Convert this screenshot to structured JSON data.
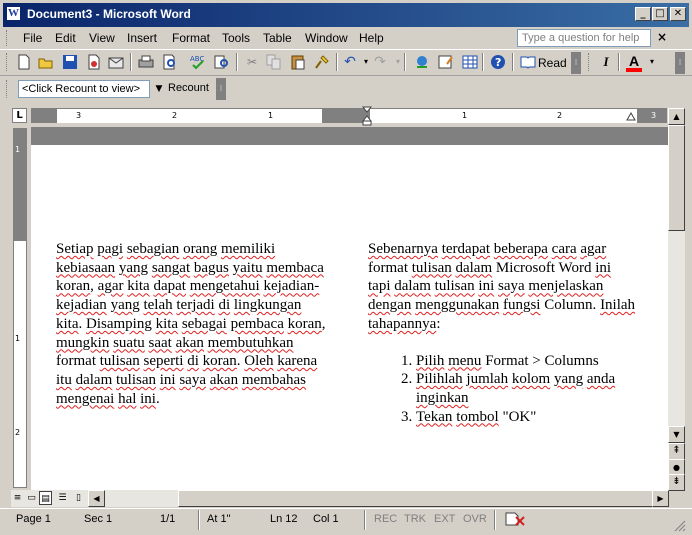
{
  "window": {
    "title": "Document3 - Microsoft Word",
    "app_icon_letter": "W"
  },
  "caption_buttons": {
    "minimize": "_",
    "maximize": "□",
    "close": "✕"
  },
  "menubar": {
    "items": [
      "File",
      "Edit",
      "View",
      "Insert",
      "Format",
      "Tools",
      "Table",
      "Window",
      "Help"
    ],
    "help_placeholder": "Type a question for help",
    "doc_close": "×"
  },
  "toolbar_standard": {
    "read_label": "Read",
    "font_color_letter": "A",
    "italic_letter": "I"
  },
  "toolbar_wordcount": {
    "view_placeholder": "<Click Recount to view>",
    "recount_label": "Recount"
  },
  "ruler": {
    "tab_selector": "L",
    "marks": [
      "3",
      "2",
      "1",
      "1",
      "2",
      "3"
    ]
  },
  "document": {
    "column1": [
      {
        "t": "Setiap",
        "s": true
      },
      {
        "t": " ",
        "s": false
      },
      {
        "t": "pagi",
        "s": true
      },
      {
        "t": " ",
        "s": false
      },
      {
        "t": "sebagian",
        "s": true
      },
      {
        "t": " ",
        "s": false
      },
      {
        "t": "orang",
        "s": true
      },
      {
        "t": " ",
        "s": false
      },
      {
        "t": "memiliki",
        "s": true
      },
      {
        "t": " ",
        "s": false
      },
      {
        "t": "kebiasaan",
        "s": true
      },
      {
        "t": " ",
        "s": false
      },
      {
        "t": "yang",
        "s": true
      },
      {
        "t": " ",
        "s": false
      },
      {
        "t": "sangat",
        "s": true
      },
      {
        "t": " ",
        "s": false
      },
      {
        "t": "bagus",
        "s": true
      },
      {
        "t": " ",
        "s": false
      },
      {
        "t": "yaitu",
        "s": true
      },
      {
        "t": " ",
        "s": false
      },
      {
        "t": "membaca",
        "s": true
      },
      {
        "t": " ",
        "s": false
      },
      {
        "t": "koran",
        "s": true
      },
      {
        "t": ", ",
        "s": false
      },
      {
        "t": "agar",
        "s": true
      },
      {
        "t": " ",
        "s": false
      },
      {
        "t": "kita",
        "s": true
      },
      {
        "t": " ",
        "s": false
      },
      {
        "t": "dapat",
        "s": true
      },
      {
        "t": " ",
        "s": false
      },
      {
        "t": "mengetahui",
        "s": true
      },
      {
        "t": " ",
        "s": false
      },
      {
        "t": "kejadian-kejadian",
        "s": true
      },
      {
        "t": " ",
        "s": false
      },
      {
        "t": "yang",
        "s": true
      },
      {
        "t": " ",
        "s": false
      },
      {
        "t": "telah",
        "s": true
      },
      {
        "t": " ",
        "s": false
      },
      {
        "t": "terjadi",
        "s": true
      },
      {
        "t": " ",
        "s": false
      },
      {
        "t": "di",
        "s": true
      },
      {
        "t": " ",
        "s": false
      },
      {
        "t": "lingkungan",
        "s": true
      },
      {
        "t": " ",
        "s": false
      },
      {
        "t": "kita",
        "s": true
      },
      {
        "t": ". ",
        "s": false
      },
      {
        "t": "Disamping",
        "s": true
      },
      {
        "t": " ",
        "s": false
      },
      {
        "t": "kita",
        "s": true
      },
      {
        "t": " ",
        "s": false
      },
      {
        "t": "sebagai",
        "s": true
      },
      {
        "t": " ",
        "s": false
      },
      {
        "t": "pembaca",
        "s": true
      },
      {
        "t": " ",
        "s": false
      },
      {
        "t": "koran",
        "s": true
      },
      {
        "t": ", ",
        "s": false
      },
      {
        "t": "mungkin",
        "s": true
      },
      {
        "t": " ",
        "s": false
      },
      {
        "t": "suatu",
        "s": true
      },
      {
        "t": " ",
        "s": false
      },
      {
        "t": "saat",
        "s": true
      },
      {
        "t": " ",
        "s": false
      },
      {
        "t": "akan",
        "s": true
      },
      {
        "t": " ",
        "s": false
      },
      {
        "t": "membutuhkan",
        "s": true
      },
      {
        "t": " format ",
        "s": false
      },
      {
        "t": "tulisan",
        "s": true
      },
      {
        "t": " ",
        "s": false
      },
      {
        "t": "seperti",
        "s": true
      },
      {
        "t": " ",
        "s": false
      },
      {
        "t": "di",
        "s": true
      },
      {
        "t": " ",
        "s": false
      },
      {
        "t": "koran",
        "s": true
      },
      {
        "t": ". ",
        "s": false
      },
      {
        "t": "Oleh",
        "s": true
      },
      {
        "t": " ",
        "s": false
      },
      {
        "t": "karena",
        "s": true
      },
      {
        "t": " ",
        "s": false
      },
      {
        "t": "itu",
        "s": true
      },
      {
        "t": " ",
        "s": false
      },
      {
        "t": "dalam",
        "s": true
      },
      {
        "t": " ",
        "s": false
      },
      {
        "t": "tulisan",
        "s": true
      },
      {
        "t": " ",
        "s": false
      },
      {
        "t": "ini",
        "s": true
      },
      {
        "t": " ",
        "s": false
      },
      {
        "t": "saya",
        "s": true
      },
      {
        "t": " ",
        "s": false
      },
      {
        "t": "akan",
        "s": true
      },
      {
        "t": " ",
        "s": false
      },
      {
        "t": "membahas",
        "s": true
      },
      {
        "t": " ",
        "s": false
      },
      {
        "t": "mengenai",
        "s": true
      },
      {
        "t": " ",
        "s": false
      },
      {
        "t": "hal",
        "s": true
      },
      {
        "t": " ",
        "s": false
      },
      {
        "t": "ini",
        "s": true
      },
      {
        "t": ".",
        "s": false
      }
    ],
    "column2": [
      {
        "t": "Sebenarnya",
        "s": true
      },
      {
        "t": " ",
        "s": false
      },
      {
        "t": "terdapat",
        "s": true
      },
      {
        "t": " ",
        "s": false
      },
      {
        "t": "beberapa",
        "s": true
      },
      {
        "t": " ",
        "s": false
      },
      {
        "t": "cara",
        "s": true
      },
      {
        "t": " ",
        "s": false
      },
      {
        "t": "agar",
        "s": true
      },
      {
        "t": " ",
        "s": false
      },
      {
        "t": "format ",
        "s": false
      },
      {
        "t": "tulisan",
        "s": true
      },
      {
        "t": " ",
        "s": false
      },
      {
        "t": "dalam",
        "s": true
      },
      {
        "t": " Microsoft Word ",
        "s": false
      },
      {
        "t": "ini",
        "s": true
      },
      {
        "t": " ",
        "s": false
      },
      {
        "t": "tapi",
        "s": true
      },
      {
        "t": " ",
        "s": false
      },
      {
        "t": "dalam",
        "s": true
      },
      {
        "t": " ",
        "s": false
      },
      {
        "t": "tulisan",
        "s": true
      },
      {
        "t": " ",
        "s": false
      },
      {
        "t": "ini",
        "s": true
      },
      {
        "t": " ",
        "s": false
      },
      {
        "t": "saya",
        "s": true
      },
      {
        "t": " ",
        "s": false
      },
      {
        "t": "menjelaskan",
        "s": true
      },
      {
        "t": " ",
        "s": false
      },
      {
        "t": "dengan",
        "s": true
      },
      {
        "t": " ",
        "s": false
      },
      {
        "t": "menggunakan",
        "s": true
      },
      {
        "t": " ",
        "s": false
      },
      {
        "t": "fungsi",
        "s": true
      },
      {
        "t": " Column. ",
        "s": false
      },
      {
        "t": "Inilah",
        "s": true
      },
      {
        "t": " ",
        "s": false
      },
      {
        "t": "tahapannya",
        "s": true
      },
      {
        "t": ":",
        "s": false
      }
    ],
    "steps": [
      [
        {
          "t": "Pilih",
          "s": true
        },
        {
          "t": " ",
          "s": false
        },
        {
          "t": "menu",
          "s": true
        },
        {
          "t": " Format > Columns",
          "s": false
        }
      ],
      [
        {
          "t": "Pilihlah",
          "s": true
        },
        {
          "t": " ",
          "s": false
        },
        {
          "t": "jumlah",
          "s": true
        },
        {
          "t": " ",
          "s": false
        },
        {
          "t": "kolom",
          "s": true
        },
        {
          "t": " ",
          "s": false
        },
        {
          "t": "yang",
          "s": true
        },
        {
          "t": " ",
          "s": false
        },
        {
          "t": "anda",
          "s": true
        },
        {
          "t": " ",
          "s": false
        },
        {
          "t": "inginkan",
          "s": true
        }
      ],
      [
        {
          "t": "Tekan",
          "s": true
        },
        {
          "t": " ",
          "s": false
        },
        {
          "t": "tombol",
          "s": true
        },
        {
          "t": " \"OK\"",
          "s": false
        }
      ]
    ]
  },
  "statusbar": {
    "page": "Page 1",
    "sec": "Sec 1",
    "pages": "1/1",
    "at": "At 1\"",
    "ln": "Ln 12",
    "col": "Col 1",
    "rec": "REC",
    "trk": "TRK",
    "ext": "EXT",
    "ovr": "OVR"
  },
  "colors": {
    "titlebar_start": "#0a246a",
    "titlebar_end": "#3a6ea5",
    "chrome": "#d4d0c8",
    "squiggle": "#e02020",
    "font_color_bar": "#ff0000"
  }
}
